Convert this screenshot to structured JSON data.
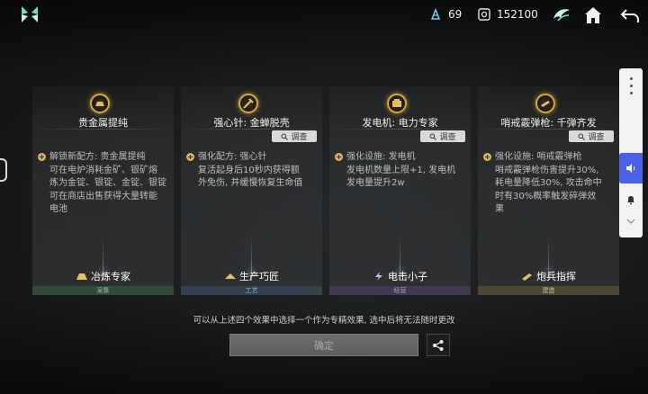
{
  "topbar": {
    "res1_icon": "energy-crystal-icon",
    "res1_value": "69",
    "res2_icon": "gear-box-icon",
    "res2_value": "152100",
    "icons": [
      "wing-emblem-icon",
      "home-icon",
      "back-arrow-icon"
    ]
  },
  "cards": [
    {
      "title": "贵金属提纯",
      "investigate": "",
      "desc": "解锁新配方: 贵金属提纯\n可在电炉消耗金矿、银矿熔\n炼为金锭、银锭、金锭、银锭\n可在商店出售获得大量转能\n电池",
      "skill": "冶炼专家",
      "category": "采集"
    },
    {
      "title": "强心针: 金蝉脱壳",
      "investigate": "调查",
      "desc": "强化配方: 强心针\n复活起身后10秒内获得额\n外免伤, 并缓慢恢复生命值",
      "skill": "生产巧匠",
      "category": "工艺"
    },
    {
      "title": "发电机: 电力专家",
      "investigate": "调查",
      "desc": "强化设施: 发电机\n发电机数量上限+1, 发电机\n发电量提升2w",
      "skill": "电击小子",
      "category": "经营"
    },
    {
      "title": "哨戒霰弹枪: 千弹齐发",
      "investigate": "调查",
      "desc": "强化设施: 哨戒霰弹枪\n哨戒霰弹枪伤害提升30%,\n耗电量降低30%, 攻击命中\n时有30%概率触发碎弹效\n果",
      "skill": "炮兵指挥",
      "category": "建造"
    }
  ],
  "hint": "可以从上述四个效果中选择一个作为专精效果, 选中后将无法随时更改",
  "confirm_label": "确定",
  "colors": {
    "accent_gold": "#d8a83a",
    "side_active": "#4a62e6",
    "confirm_bg": "#666666"
  }
}
